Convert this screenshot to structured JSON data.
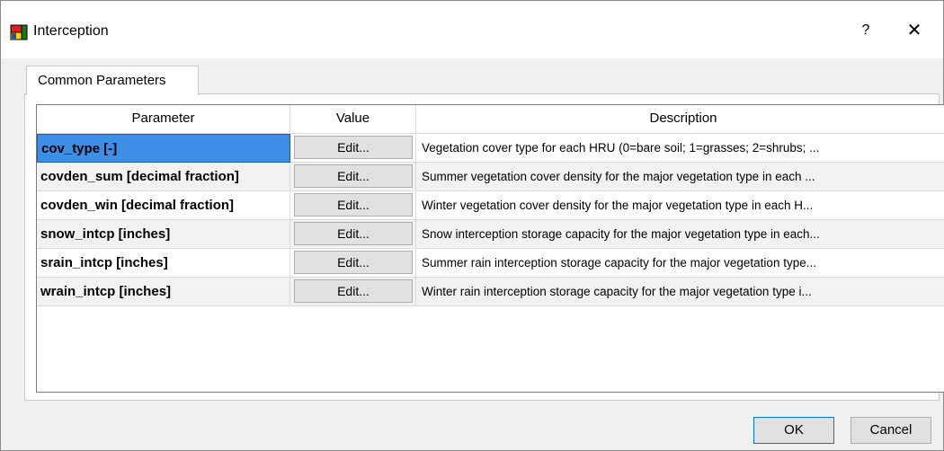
{
  "window": {
    "title": "Interception",
    "help_label": "?",
    "close_label": "✕"
  },
  "tabs": [
    {
      "label": "Common Parameters",
      "active": true
    }
  ],
  "table": {
    "columns": [
      "Parameter",
      "Value",
      "Description"
    ],
    "rows": [
      {
        "parameter": "cov_type [-]",
        "value": "Edit...",
        "description": "Vegetation cover type for each HRU (0=bare soil; 1=grasses; 2=shrubs; ...",
        "selected": true
      },
      {
        "parameter": "covden_sum [decimal fraction]",
        "value": "Edit...",
        "description": "Summer vegetation cover density for the major vegetation type in each ..."
      },
      {
        "parameter": "covden_win  [decimal fraction]",
        "value": "Edit...",
        "description": "Winter vegetation cover density for the major vegetation type in each H..."
      },
      {
        "parameter": "snow_intcp [inches]",
        "value": "Edit...",
        "description": "Snow interception storage capacity for the major vegetation type in each..."
      },
      {
        "parameter": "srain_intcp [inches]",
        "value": "Edit...",
        "description": "Summer rain interception storage capacity for the major vegetation type..."
      },
      {
        "parameter": "wrain_intcp [inches]",
        "value": "Edit...",
        "description": "Winter rain interception storage capacity for the major vegetation type i..."
      }
    ]
  },
  "buttons": {
    "ok": "OK",
    "cancel": "Cancel"
  },
  "colors": {
    "selection": "#3d8ee6",
    "alt_row": "#f2f2f2"
  }
}
